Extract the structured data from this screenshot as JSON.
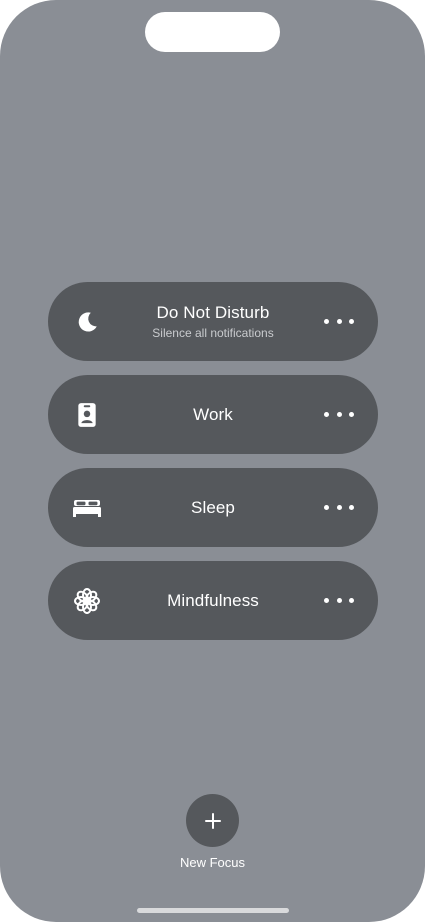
{
  "focus_modes": [
    {
      "title": "Do Not Disturb",
      "subtitle": "Silence all notifications",
      "icon": "moon-icon"
    },
    {
      "title": "Work",
      "subtitle": "",
      "icon": "id-badge-icon"
    },
    {
      "title": "Sleep",
      "subtitle": "",
      "icon": "bed-icon"
    },
    {
      "title": "Mindfulness",
      "subtitle": "",
      "icon": "flower-icon"
    }
  ],
  "more_icon": "ellipsis-icon",
  "new_focus": {
    "label": "New Focus",
    "icon": "plus-icon"
  },
  "colors": {
    "background": "#8a8e95",
    "tile": "#55585c",
    "text": "#ffffff",
    "subtext": "#c9cbce"
  }
}
